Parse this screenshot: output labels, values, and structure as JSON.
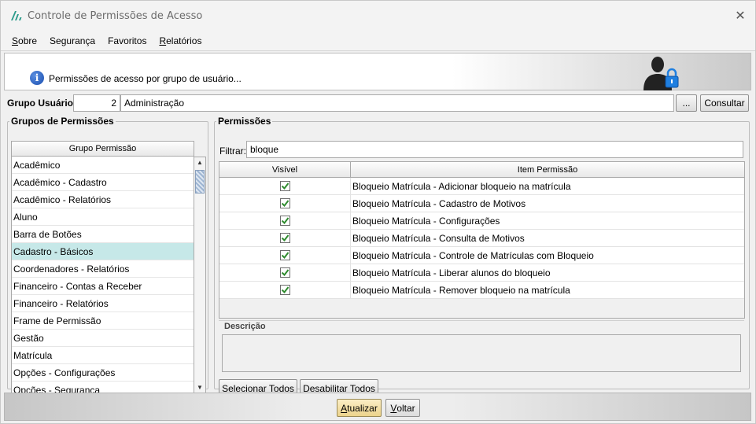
{
  "window": {
    "title": "Controle de Permissões de Acesso",
    "close_glyph": "✕"
  },
  "menu": [
    {
      "label": "Sobre"
    },
    {
      "label": "Segurança"
    },
    {
      "label": "Favoritos"
    },
    {
      "label": "Relatórios"
    }
  ],
  "banner": {
    "text": "Permissões de acesso por grupo de usuário...",
    "info_icon": "info-icon",
    "user_icon": "user-lock-icon"
  },
  "user_group": {
    "label": "Grupo Usuário:",
    "code": "2",
    "name": "Administração",
    "browse_label": "...",
    "consult_label": "Consultar"
  },
  "permission_groups": {
    "legend": "Grupos de Permissões",
    "column_header": "Grupo Permissão",
    "selected_index": 5,
    "items": [
      "Acadêmico",
      "Acadêmico - Cadastro",
      "Acadêmico - Relatórios",
      "Aluno",
      "Barra de Botões",
      "Cadastro - Básicos",
      "Coordenadores - Relatórios",
      "Financeiro - Contas a Receber",
      "Financeiro - Relatórios",
      "Frame de Permissão",
      "Gestão",
      "Matrícula",
      "Opções - Configurações",
      "Opções - Segurança"
    ]
  },
  "permissions": {
    "legend": "Permissões",
    "filter_label": "Filtrar:",
    "filter_value": "bloque",
    "columns": {
      "visible": "Visível",
      "item": "Item Permissão"
    },
    "rows": [
      {
        "visible": true,
        "item": "Bloqueio Matrícula - Adicionar bloqueio na matrícula"
      },
      {
        "visible": true,
        "item": "Bloqueio Matrícula - Cadastro de Motivos"
      },
      {
        "visible": true,
        "item": "Bloqueio Matrícula - Configurações"
      },
      {
        "visible": true,
        "item": "Bloqueio Matrícula - Consulta de Motivos"
      },
      {
        "visible": true,
        "item": "Bloqueio Matrícula - Controle de Matrículas com Bloqueio"
      },
      {
        "visible": true,
        "item": "Bloqueio Matrícula - Liberar alunos do bloqueio"
      },
      {
        "visible": true,
        "item": "Bloqueio Matrícula - Remover bloqueio na matrícula"
      }
    ],
    "description_label": "Descrição",
    "select_all_label": "Selecionar Todos",
    "disable_all_label": "Desabilitar Todos"
  },
  "footer": {
    "update_label": "Atualizar",
    "back_label": "Voltar"
  },
  "colors": {
    "selected_row": "#c6e8e8",
    "checkbox_green": "#2e8b2e",
    "update_button": "#ecd38b"
  }
}
